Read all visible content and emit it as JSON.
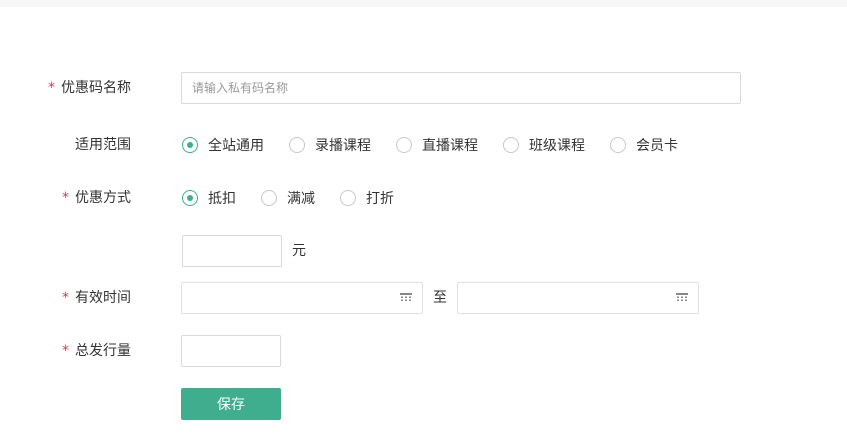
{
  "form": {
    "coupon_name": {
      "label": "优惠码名称",
      "required": "*",
      "placeholder": "请输入私有码名称",
      "value": ""
    },
    "scope": {
      "label": "适用范围",
      "options": [
        "全站通用",
        "录播课程",
        "直播课程",
        "班级课程",
        "会员卡"
      ],
      "selected": "全站通用"
    },
    "discount_method": {
      "label": "优惠方式",
      "required": "*",
      "options": [
        "抵扣",
        "满减",
        "打折"
      ],
      "selected": "抵扣"
    },
    "amount": {
      "value": "",
      "unit": "元"
    },
    "valid_time": {
      "label": "有效时间",
      "required": "*",
      "separator": "至",
      "start": "",
      "end": ""
    },
    "total_issue": {
      "label": "总发行量",
      "required": "*",
      "value": ""
    },
    "save_label": "保存"
  },
  "colors": {
    "accent": "#3fae8e",
    "required": "#e4393c"
  }
}
